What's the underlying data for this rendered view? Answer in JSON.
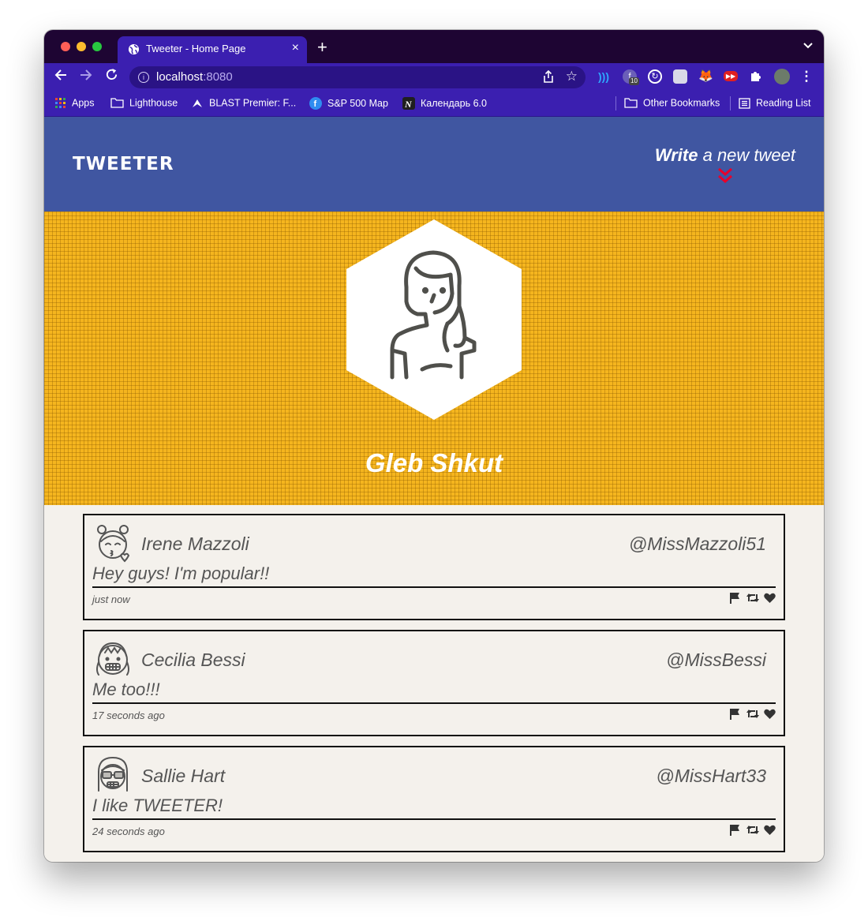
{
  "browser": {
    "tab_title": "Tweeter - Home Page",
    "url_host": "localhost",
    "url_port": ":8080",
    "extension_badge": "10",
    "bookmarks": [
      {
        "label": "Apps",
        "icon": "apps-grid-icon"
      },
      {
        "label": "Lighthouse",
        "icon": "folder-icon"
      },
      {
        "label": "BLAST Premier: F...",
        "icon": "blast-icon"
      },
      {
        "label": "S&P 500 Map",
        "icon": "finviz-icon"
      },
      {
        "label": "Календарь 6.0",
        "icon": "notion-icon"
      }
    ],
    "other_bookmarks": "Other Bookmarks",
    "reading_list": "Reading List"
  },
  "nav": {
    "logo": "TWEETER",
    "compose_bold": "Write",
    "compose_rest": " a new tweet"
  },
  "profile": {
    "name": "Gleb Shkut"
  },
  "tweets": [
    {
      "name": "Irene Mazzoli",
      "handle": "@MissMazzoli51",
      "text": "Hey guys! I'm popular!!",
      "time": "just now"
    },
    {
      "name": "Cecilia Bessi",
      "handle": "@MissBessi",
      "text": "Me too!!!",
      "time": "17 seconds ago"
    },
    {
      "name": "Sallie Hart",
      "handle": "@MissHart33",
      "text": "I like TWEETER!",
      "time": "24 seconds ago"
    }
  ],
  "colors": {
    "nav_bg": "#4056a1",
    "hero_bg": "#f5b51e",
    "page_bg": "#f4f1ec",
    "browser_chrome": "#3b1fb0",
    "accent_red": "#e8002a"
  }
}
